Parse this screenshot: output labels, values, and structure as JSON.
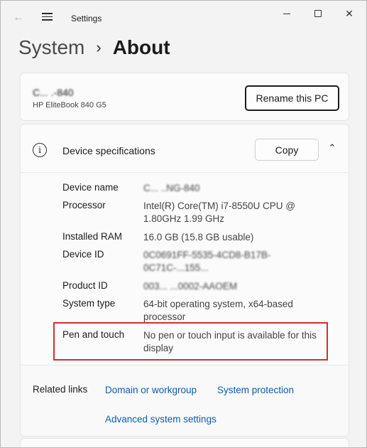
{
  "titlebar": {
    "back_icon": "back-arrow-icon",
    "menu_icon": "hamburger-menu-icon",
    "title": "Settings",
    "min_label": "",
    "max_label": "",
    "close_glyph": "✕"
  },
  "breadcrumb": {
    "parent": "System",
    "separator": "›",
    "current": "About"
  },
  "pc_card": {
    "name": "C... .-840",
    "model": "HP EliteBook 840 G5",
    "rename_button": "Rename this PC"
  },
  "specs": {
    "title": "Device specifications",
    "copy_button": "Copy",
    "chevron": "⌃",
    "rows": [
      {
        "label": "Device name",
        "value": "C... ..NG-840"
      },
      {
        "label": "Processor",
        "value": "Intel(R) Core(TM) i7-8550U CPU @ 1.80GHz   1.99 GHz"
      },
      {
        "label": "Installed RAM",
        "value": "16.0 GB (15.8 GB usable)"
      },
      {
        "label": "Device ID",
        "value": "0C0691FF-5535-4CD8-B17B-0C71C-...155..."
      },
      {
        "label": "Product ID",
        "value": "003... ...0002-AAOEM"
      },
      {
        "label": "System type",
        "value": "64-bit operating system, x64-based processor"
      },
      {
        "label": "Pen and touch",
        "value": "No pen or touch input is available for this display"
      }
    ]
  },
  "related": {
    "label": "Related links",
    "links": [
      "Domain or workgroup",
      "System protection",
      "Advanced system settings"
    ]
  }
}
